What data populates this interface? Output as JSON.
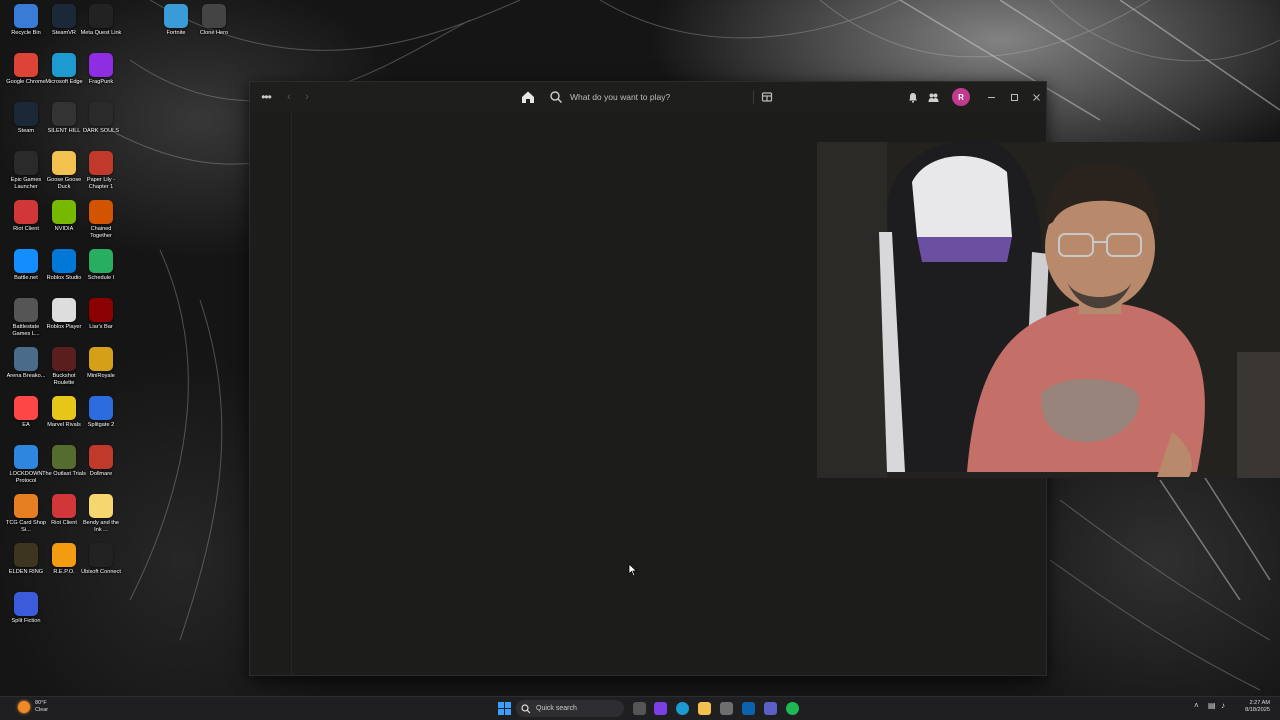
{
  "desktop": {
    "icons": [
      {
        "label": "Recycle Bin",
        "icon": "recycle-bin-icon",
        "color": "#3a7bd5"
      },
      {
        "label": "SteamVR",
        "icon": "steamvr-icon",
        "color": "#1b2838"
      },
      {
        "label": "Meta Quest Link",
        "icon": "meta-icon",
        "color": "#222222"
      },
      {
        "label": "Fortnite",
        "icon": "fortnite-icon",
        "color": "#3a9bd9"
      },
      {
        "label": "Clone Hero",
        "icon": "clone-hero-icon",
        "color": "#444444"
      },
      {
        "label": "Google Chrome",
        "icon": "chrome-icon",
        "color": "#db4437"
      },
      {
        "label": "Microsoft Edge",
        "icon": "edge-icon",
        "color": "#1d9bd1"
      },
      {
        "label": "FragPunk",
        "icon": "fragpunk-icon",
        "color": "#8e2de2"
      },
      {
        "label": "Steam",
        "icon": "steam-icon",
        "color": "#1b2838"
      },
      {
        "label": "SILENT HILL",
        "icon": "silent-hill-icon",
        "color": "#333333"
      },
      {
        "label": "DARK SOULS",
        "icon": "dark-souls-icon",
        "color": "#2a2a2a"
      },
      {
        "label": "Epic Games Launcher",
        "icon": "epic-games-icon",
        "color": "#2a2a2a"
      },
      {
        "label": "Goose Goose Duck",
        "icon": "goose-goose-duck-icon",
        "color": "#f2c14e"
      },
      {
        "label": "Paper Lily - Chapter 1",
        "icon": "paper-lily-icon",
        "color": "#c0392b"
      },
      {
        "label": "Riot Client",
        "icon": "riot-client-icon",
        "color": "#d13639"
      },
      {
        "label": "NVIDIA",
        "icon": "nvidia-icon",
        "color": "#76b900"
      },
      {
        "label": "Chained Together",
        "icon": "chained-together-icon",
        "color": "#d35400"
      },
      {
        "label": "Battle.net",
        "icon": "battlenet-icon",
        "color": "#148eff"
      },
      {
        "label": "Roblox Studio",
        "icon": "roblox-studio-icon",
        "color": "#0078d7"
      },
      {
        "label": "Schedule I",
        "icon": "schedule-i-icon",
        "color": "#27ae60"
      },
      {
        "label": "Battlestate Games L...",
        "icon": "battlestate-icon",
        "color": "#555555"
      },
      {
        "label": "Roblox Player",
        "icon": "roblox-player-icon",
        "color": "#dddddd"
      },
      {
        "label": "Liar's Bar",
        "icon": "liars-bar-icon",
        "color": "#8b0000"
      },
      {
        "label": "Arena Breako...",
        "icon": "arena-breakout-icon",
        "color": "#4a6b8a"
      },
      {
        "label": "Buckshot Roulette",
        "icon": "buckshot-roulette-icon",
        "color": "#5a1e1e"
      },
      {
        "label": "MiniRoyale",
        "icon": "miniroyale-icon",
        "color": "#d4a017"
      },
      {
        "label": "EA",
        "icon": "ea-icon",
        "color": "#ff4747"
      },
      {
        "label": "Marvel Rivals",
        "icon": "marvel-rivals-icon",
        "color": "#e6c619"
      },
      {
        "label": "Splitgate 2",
        "icon": "splitgate-icon",
        "color": "#2d6cdf"
      },
      {
        "label": "LOCKDOWN Protocol",
        "icon": "lockdown-protocol-icon",
        "color": "#2e86de"
      },
      {
        "label": "The Outlast Trials",
        "icon": "outlast-trials-icon",
        "color": "#556b2f"
      },
      {
        "label": "Dollmare",
        "icon": "dollmare-icon",
        "color": "#c0392b"
      },
      {
        "label": "TCG Card Shop Si...",
        "icon": "tcg-card-shop-icon",
        "color": "#e67e22"
      },
      {
        "label": "Riot Client",
        "icon": "riot-client-icon",
        "color": "#d13639"
      },
      {
        "label": "Bendy and the Ink ...",
        "icon": "bendy-icon",
        "color": "#f5d76e"
      },
      {
        "label": "ELDEN RING",
        "icon": "elden-ring-icon",
        "color": "#3d3520"
      },
      {
        "label": "R.E.P.O.",
        "icon": "repo-icon",
        "color": "#f39c12"
      },
      {
        "label": "Ubisoft Connect",
        "icon": "ubisoft-icon",
        "color": "#222222"
      },
      {
        "label": "Split Fiction",
        "icon": "split-fiction-icon",
        "color": "#3b5bdb"
      }
    ]
  },
  "app": {
    "menu_icon": "more-horizontal-icon",
    "search_placeholder": "What do you want to play?",
    "avatar_initial": "R",
    "avatar_color": "#c23a8d",
    "background_color": "#1c1d1b"
  },
  "taskbar": {
    "weather_temp": "80°F",
    "weather_desc": "Clear",
    "search_label": "Quick search",
    "time": "2:27 AM",
    "date": "8/18/2025"
  }
}
